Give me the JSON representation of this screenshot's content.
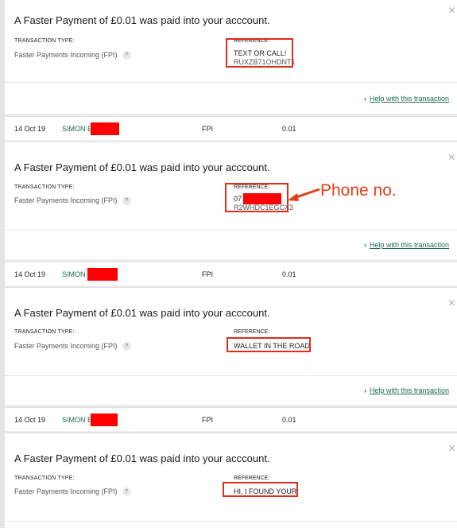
{
  "cards": [
    {
      "title": "A Faster Payment of £0.01 was paid into your acccount.",
      "tt_label": "TRANSACTION TYPE:",
      "tt_value": "Faster Payments Incoming (FPI)",
      "help_icon": "?",
      "ref_label": "REFERENCE:",
      "ref_line1": "TEXT OR CALL!",
      "ref_line2": "RUXZB71OHDNT1",
      "help_link": "Help with this transaction",
      "close_icon": "×"
    },
    {
      "title": "A Faster Payment of £0.01 was paid into your acccount.",
      "tt_label": "TRANSACTION TYPE:",
      "tt_value": "Faster Payments Incoming (FPI)",
      "help_icon": "?",
      "ref_label": "REFERENCE:",
      "ref_line1": "077",
      "ref_line2": "R2WHDC1EGCX3",
      "help_link": "Help with this transaction",
      "close_icon": "×"
    },
    {
      "title": "A Faster Payment of £0.01 was paid into your acccount.",
      "tt_label": "TRANSACTION TYPE:",
      "tt_value": "Faster Payments Incoming (FPI)",
      "help_icon": "?",
      "ref_label": "REFERENCE:",
      "ref_line1": "WALLET IN THE ROAD",
      "help_link": "Help with this transaction",
      "close_icon": "×"
    },
    {
      "title": "A Faster Payment of £0.01 was paid into your acccount.",
      "tt_label": "TRANSACTION TYPE:",
      "tt_value": "Faster Payments Incoming (FPI)",
      "help_icon": "?",
      "ref_label": "REFERENCE:",
      "ref_line1": "HI, I FOUND YOUR",
      "close_icon": "×"
    }
  ],
  "rows": [
    {
      "date": "14 Oct 19",
      "name": "SIMON E",
      "type": "FPI",
      "amount": "0.01"
    },
    {
      "date": "14 Oct 19",
      "name": "SIMON",
      "type": "FPI",
      "amount": "0.01"
    },
    {
      "date": "14 Oct 19",
      "name": "SIMON E",
      "type": "FPI",
      "amount": "0.01"
    }
  ],
  "annotation": {
    "text": "Phone no.",
    "color": "#e0401b"
  },
  "colors": {
    "accent_green": "#1e6b4f",
    "highlight_red": "#e02d1b",
    "redaction": "#ff0000"
  }
}
